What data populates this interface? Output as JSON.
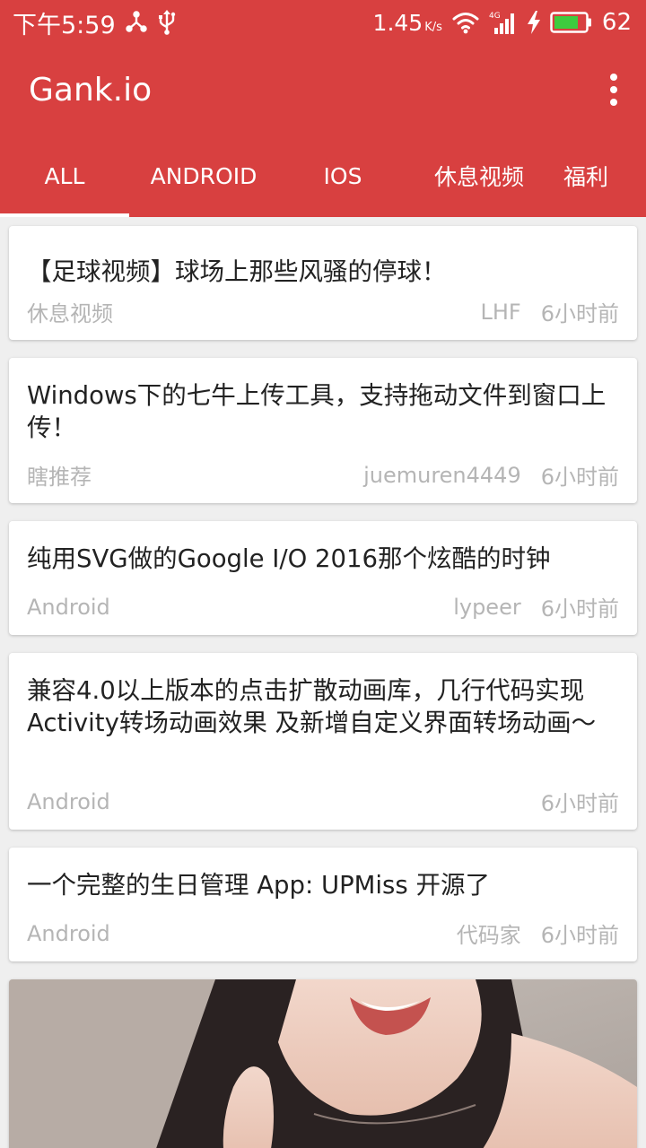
{
  "status_bar": {
    "time": "下午5:59",
    "speed_value": "1.45",
    "speed_unit": "K/s",
    "network": "4G",
    "battery_level": "62",
    "icons": [
      "usb-tether-icon",
      "usb-icon",
      "wifi-icon",
      "signal-icon",
      "charging-icon",
      "battery-icon"
    ]
  },
  "toolbar": {
    "title": "Gank.io",
    "menu_icon": "overflow-menu-icon"
  },
  "tabs": [
    {
      "label": "ALL",
      "selected": true
    },
    {
      "label": "ANDROID",
      "selected": false
    },
    {
      "label": "IOS",
      "selected": false
    },
    {
      "label": "休息视频",
      "selected": false
    },
    {
      "label": "福利",
      "selected": false
    }
  ],
  "feed": [
    {
      "title": "【足球视频】球场上那些风骚的停球！",
      "category": "休息视频",
      "author": "LHF",
      "time": "6小时前"
    },
    {
      "title": "Windows下的七牛上传工具，支持拖动文件到窗口上传！",
      "category": "瞎推荐",
      "author": "juemuren4449",
      "time": "6小时前"
    },
    {
      "title": "纯用SVG做的Google I/O 2016那个炫酷的时钟",
      "category": "Android",
      "author": "lypeer",
      "time": "6小时前"
    },
    {
      "title": "兼容4.0以上版本的点击扩散动画库，几行代码实现Activity转场动画效果 及新增自定义界面转场动画～",
      "category": "Android",
      "author": "",
      "time": "6小时前"
    },
    {
      "title": "一个完整的生日管理 App: UPMiss 开源了",
      "category": "Android",
      "author": "代码家",
      "time": "6小时前"
    }
  ],
  "colors": {
    "primary": "#d84040",
    "background": "#efefef",
    "card": "#ffffff",
    "title_text": "#222222",
    "meta_text": "#b5b5b5",
    "battery_fill": "#3ecc3e"
  }
}
